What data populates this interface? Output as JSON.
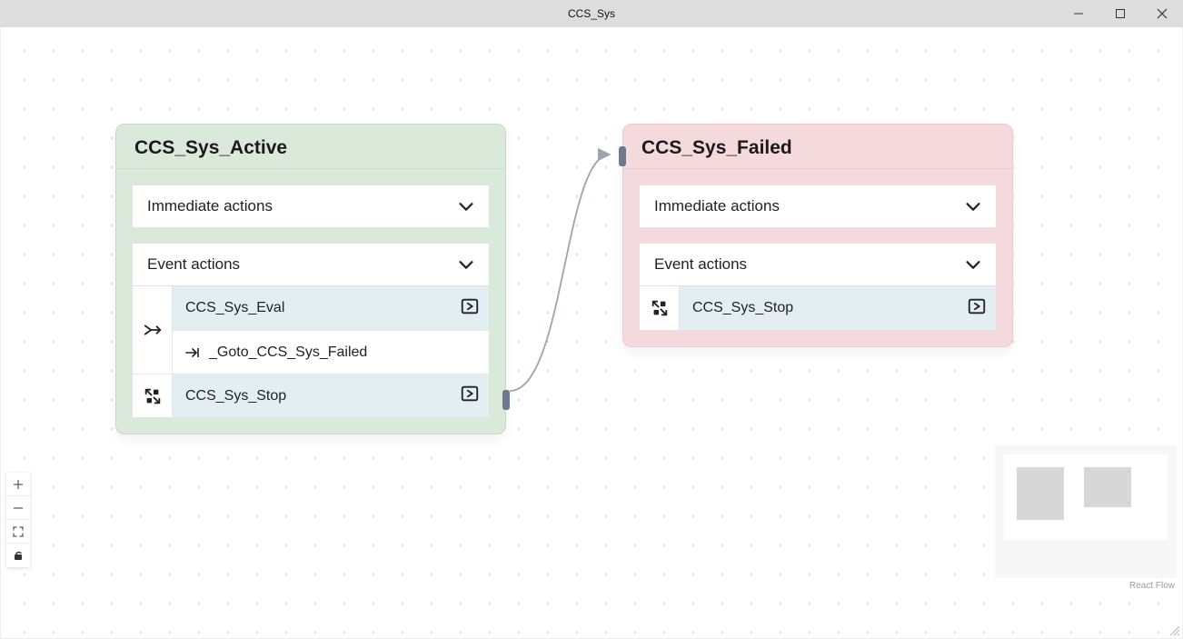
{
  "window": {
    "title": "CCS_Sys"
  },
  "attribution": "React Flow",
  "nodes": {
    "active": {
      "title": "CCS_Sys_Active",
      "immediate_header": "Immediate actions",
      "event_header": "Event actions",
      "event_items": {
        "eval": "CCS_Sys_Eval",
        "goto": "_Goto_CCS_Sys_Failed",
        "stop": "CCS_Sys_Stop"
      }
    },
    "failed": {
      "title": "CCS_Sys_Failed",
      "immediate_header": "Immediate actions",
      "event_header": "Event actions",
      "event_items": {
        "stop": "CCS_Sys_Stop"
      }
    }
  },
  "controls": {
    "zoom_in": "+",
    "zoom_out": "−"
  }
}
